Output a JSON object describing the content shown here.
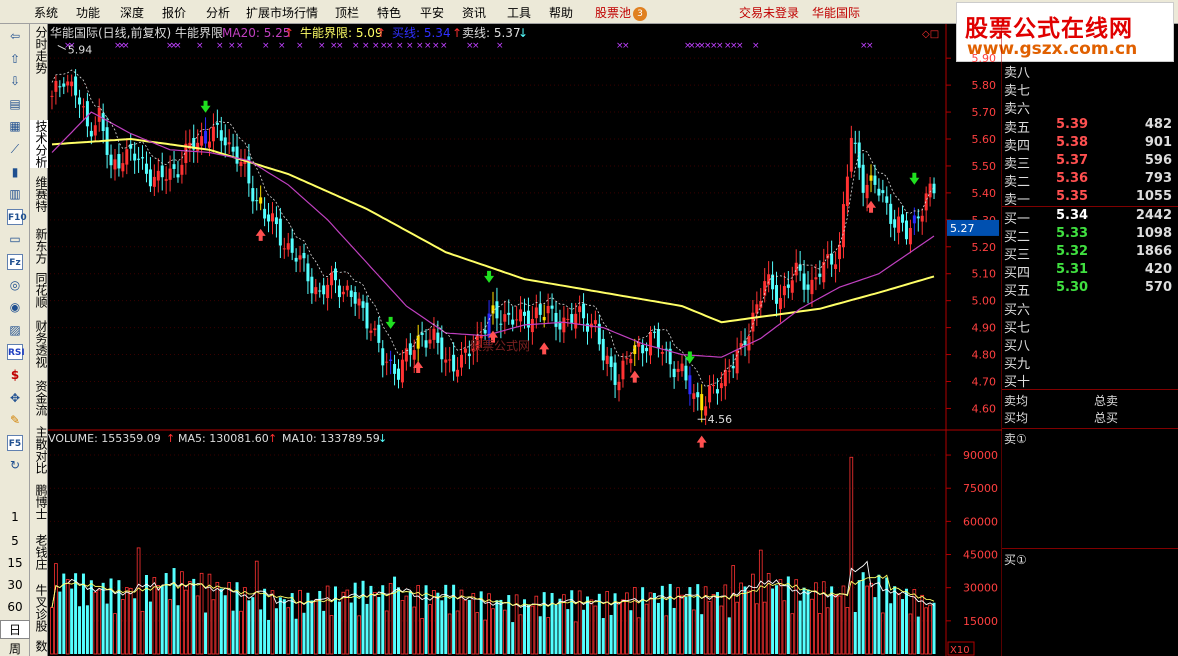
{
  "menu": {
    "items": [
      "系统",
      "功能",
      "深度",
      "报价",
      "分析",
      "扩展市场行情",
      "顶栏",
      "特色",
      "平安",
      "资讯",
      "工具",
      "帮助"
    ],
    "pool": "股票池",
    "pool_badge": "3",
    "login_status": "交易未登录",
    "stock_name": "华能国际"
  },
  "watermark": {
    "line1": "股票公式在线网",
    "line2": "www.gszx.com.cn",
    "center": "股票公式网"
  },
  "left_toolbar": {
    "icons": [
      "left-arrow-icon",
      "up-arrow-icon",
      "down-arrow-icon",
      "sort-icon",
      "table-icon",
      "line-chart-icon",
      "candle-icon",
      "grid-icon",
      "f10-icon",
      "f11-icon",
      "fz-icon",
      "f9-icon",
      "circle-icon",
      "chart2-icon",
      "rsi-icon",
      "dollar-icon",
      "move-icon",
      "pen-icon",
      "f5-icon",
      "refresh-icon"
    ],
    "rsi_label": "RSI",
    "f10_label": "F10",
    "fz_label": "Fz",
    "f5_label": "F5",
    "periods": [
      "1",
      "5",
      "15",
      "30",
      "60",
      "日",
      "周"
    ]
  },
  "vertical_tabs": [
    "分时走势",
    "技术分析",
    "维赛特",
    "新东方",
    "同花顺",
    "财务透视",
    "资金流",
    "主散对比",
    "鹏博士",
    "老钱庄",
    "牛叉诊股",
    "数"
  ],
  "chart_header": {
    "title": "华能国际(日线,前复权) 牛能界限",
    "ma20_label": "MA20: 5.25",
    "ma20_arrow": "↑",
    "bound_label": "牛能界限: 5.09",
    "bound_arrow": "↑",
    "buy_label": "买线: 5.34",
    "buy_arrow": "↑",
    "sell_label": "卖线: 5.37",
    "sell_arrow": "↓",
    "corner": "◇□"
  },
  "volume_header": {
    "volume": "VOLUME: 155359.09",
    "volume_arrow": "↑",
    "ma5": "MA5: 130081.60",
    "ma5_arrow": "↑",
    "ma10": "MA10: 133789.59",
    "ma10_arrow": "↓"
  },
  "price_axis": {
    "ticks": [
      "5.90",
      "5.80",
      "5.70",
      "5.60",
      "5.50",
      "5.40",
      "5.30",
      "5.20",
      "5.10",
      "5.00",
      "4.90",
      "4.80",
      "4.70",
      "4.60"
    ],
    "current": "5.27"
  },
  "volume_axis": {
    "ticks": [
      "90000",
      "75000",
      "60000",
      "45000",
      "30000",
      "15000"
    ],
    "unit": "X10"
  },
  "annotations": {
    "high": "5.94",
    "low": "4.56"
  },
  "order_book": {
    "asks": [
      {
        "label": "卖八",
        "price": "",
        "vol": ""
      },
      {
        "label": "卖七",
        "price": "",
        "vol": ""
      },
      {
        "label": "卖六",
        "price": "",
        "vol": ""
      },
      {
        "label": "卖五",
        "price": "5.39",
        "vol": "482"
      },
      {
        "label": "卖四",
        "price": "5.38",
        "vol": "901"
      },
      {
        "label": "卖三",
        "price": "5.37",
        "vol": "596"
      },
      {
        "label": "卖二",
        "price": "5.36",
        "vol": "793"
      },
      {
        "label": "卖一",
        "price": "5.35",
        "vol": "1055"
      }
    ],
    "bids": [
      {
        "label": "买一",
        "price": "5.34",
        "vol": "2442"
      },
      {
        "label": "买二",
        "price": "5.33",
        "vol": "1098"
      },
      {
        "label": "买三",
        "price": "5.32",
        "vol": "1866"
      },
      {
        "label": "买四",
        "price": "5.31",
        "vol": "420"
      },
      {
        "label": "买五",
        "price": "5.30",
        "vol": "570"
      },
      {
        "label": "买六",
        "price": "",
        "vol": ""
      },
      {
        "label": "买七",
        "price": "",
        "vol": ""
      },
      {
        "label": "买八",
        "price": "",
        "vol": ""
      },
      {
        "label": "买九",
        "price": "",
        "vol": ""
      },
      {
        "label": "买十",
        "price": "",
        "vol": ""
      }
    ],
    "avg_sell": "卖均",
    "avg_buy": "买均",
    "total_sell": "总卖",
    "total_buy": "总买",
    "queue_sell": "卖①",
    "queue_buy": "买①"
  },
  "colors": {
    "up": "#ff3232",
    "down": "#54ffff",
    "ma_yellow": "#ffff66",
    "ma_purple": "#c040c0",
    "ask_price": "#ff5050",
    "bid_price": "#40e040",
    "buy_line": "#3030ff"
  },
  "chart_data": {
    "type": "candlestick",
    "price_range": [
      4.52,
      5.96
    ],
    "y_ticks": [
      5.9,
      5.8,
      5.7,
      5.6,
      5.5,
      5.4,
      5.3,
      5.2,
      5.1,
      5.0,
      4.9,
      4.8,
      4.7,
      4.6
    ],
    "current_price": 5.27,
    "volume_range": [
      0,
      95000
    ],
    "volume_ticks": [
      90000,
      75000,
      60000,
      45000,
      30000,
      15000
    ],
    "close_keys": [
      [
        0,
        5.74
      ],
      [
        3,
        5.84
      ],
      [
        6,
        5.77
      ],
      [
        9,
        5.64
      ],
      [
        12,
        5.69
      ],
      [
        15,
        5.48
      ],
      [
        18,
        5.55
      ],
      [
        22,
        5.52
      ],
      [
        27,
        5.44
      ],
      [
        32,
        5.5
      ],
      [
        36,
        5.58
      ],
      [
        40,
        5.62
      ],
      [
        44,
        5.6
      ],
      [
        47,
        5.54
      ],
      [
        50,
        5.43
      ],
      [
        55,
        5.3
      ],
      [
        60,
        5.2
      ],
      [
        64,
        5.12
      ],
      [
        68,
        5.02
      ],
      [
        72,
        5.08
      ],
      [
        76,
        5.01
      ],
      [
        78,
        4.98
      ],
      [
        81,
        4.92
      ],
      [
        84,
        4.77
      ],
      [
        88,
        4.75
      ],
      [
        91,
        4.8
      ],
      [
        94,
        4.88
      ],
      [
        97,
        4.85
      ],
      [
        100,
        4.78
      ],
      [
        104,
        4.76
      ],
      [
        107,
        4.84
      ],
      [
        111,
        4.93
      ],
      [
        115,
        4.95
      ],
      [
        119,
        4.92
      ],
      [
        123,
        4.96
      ],
      [
        127,
        4.94
      ],
      [
        131,
        4.92
      ],
      [
        135,
        4.95
      ],
      [
        138,
        4.9
      ],
      [
        140,
        4.78
      ],
      [
        144,
        4.72
      ],
      [
        148,
        4.82
      ],
      [
        152,
        4.86
      ],
      [
        156,
        4.8
      ],
      [
        160,
        4.72
      ],
      [
        163,
        4.65
      ],
      [
        166,
        4.62
      ],
      [
        169,
        4.68
      ],
      [
        172,
        4.76
      ],
      [
        175,
        4.8
      ],
      [
        178,
        4.95
      ],
      [
        181,
        5.06
      ],
      [
        185,
        5.02
      ],
      [
        189,
        5.1
      ],
      [
        193,
        5.06
      ],
      [
        197,
        5.14
      ],
      [
        200,
        5.2
      ],
      [
        203,
        5.6
      ],
      [
        206,
        5.45
      ],
      [
        209,
        5.42
      ],
      [
        211,
        5.38
      ],
      [
        214,
        5.3
      ],
      [
        217,
        5.24
      ],
      [
        220,
        5.33
      ],
      [
        222,
        5.38
      ],
      [
        224,
        5.4
      ]
    ],
    "ma_yellow_keys": [
      [
        0,
        5.58
      ],
      [
        20,
        5.6
      ],
      [
        40,
        5.56
      ],
      [
        60,
        5.47
      ],
      [
        80,
        5.34
      ],
      [
        100,
        5.18
      ],
      [
        120,
        5.08
      ],
      [
        140,
        5.03
      ],
      [
        160,
        4.98
      ],
      [
        170,
        4.92
      ],
      [
        180,
        4.94
      ],
      [
        195,
        4.97
      ],
      [
        210,
        5.03
      ],
      [
        224,
        5.09
      ]
    ],
    "ma_purple_keys": [
      [
        0,
        5.55
      ],
      [
        10,
        5.7
      ],
      [
        20,
        5.62
      ],
      [
        30,
        5.56
      ],
      [
        40,
        5.55
      ],
      [
        50,
        5.52
      ],
      [
        60,
        5.43
      ],
      [
        70,
        5.3
      ],
      [
        80,
        5.14
      ],
      [
        90,
        4.98
      ],
      [
        100,
        4.88
      ],
      [
        110,
        4.87
      ],
      [
        120,
        4.91
      ],
      [
        130,
        4.92
      ],
      [
        140,
        4.9
      ],
      [
        150,
        4.84
      ],
      [
        160,
        4.8
      ],
      [
        170,
        4.79
      ],
      [
        180,
        4.86
      ],
      [
        190,
        4.97
      ],
      [
        200,
        5.05
      ],
      [
        210,
        5.1
      ],
      [
        220,
        5.2
      ],
      [
        224,
        5.24
      ]
    ],
    "vol_base_keys": [
      [
        0,
        30000
      ],
      [
        10,
        25000
      ],
      [
        20,
        24000
      ],
      [
        30,
        28000
      ],
      [
        40,
        26000
      ],
      [
        50,
        22000
      ],
      [
        60,
        20000
      ],
      [
        70,
        22000
      ],
      [
        80,
        24000
      ],
      [
        90,
        22000
      ],
      [
        100,
        23000
      ],
      [
        110,
        20000
      ],
      [
        120,
        19000
      ],
      [
        130,
        21000
      ],
      [
        140,
        20000
      ],
      [
        150,
        22000
      ],
      [
        160,
        23000
      ],
      [
        170,
        22000
      ],
      [
        180,
        28000
      ],
      [
        190,
        24000
      ],
      [
        200,
        23000
      ],
      [
        210,
        26000
      ],
      [
        224,
        18000
      ]
    ],
    "vol_spikes": [
      [
        22,
        48000
      ],
      [
        52,
        42000
      ],
      [
        87,
        35000
      ],
      [
        173,
        40000
      ],
      [
        180,
        47000
      ],
      [
        203,
        89000
      ],
      [
        206,
        37000
      ]
    ],
    "buy_signal_bars": [
      53,
      93,
      112,
      125,
      148,
      165,
      208
    ],
    "sell_signal_bars": [
      39,
      86,
      111,
      162,
      219
    ],
    "high_label_bar": 3,
    "low_label_bar": 166
  }
}
